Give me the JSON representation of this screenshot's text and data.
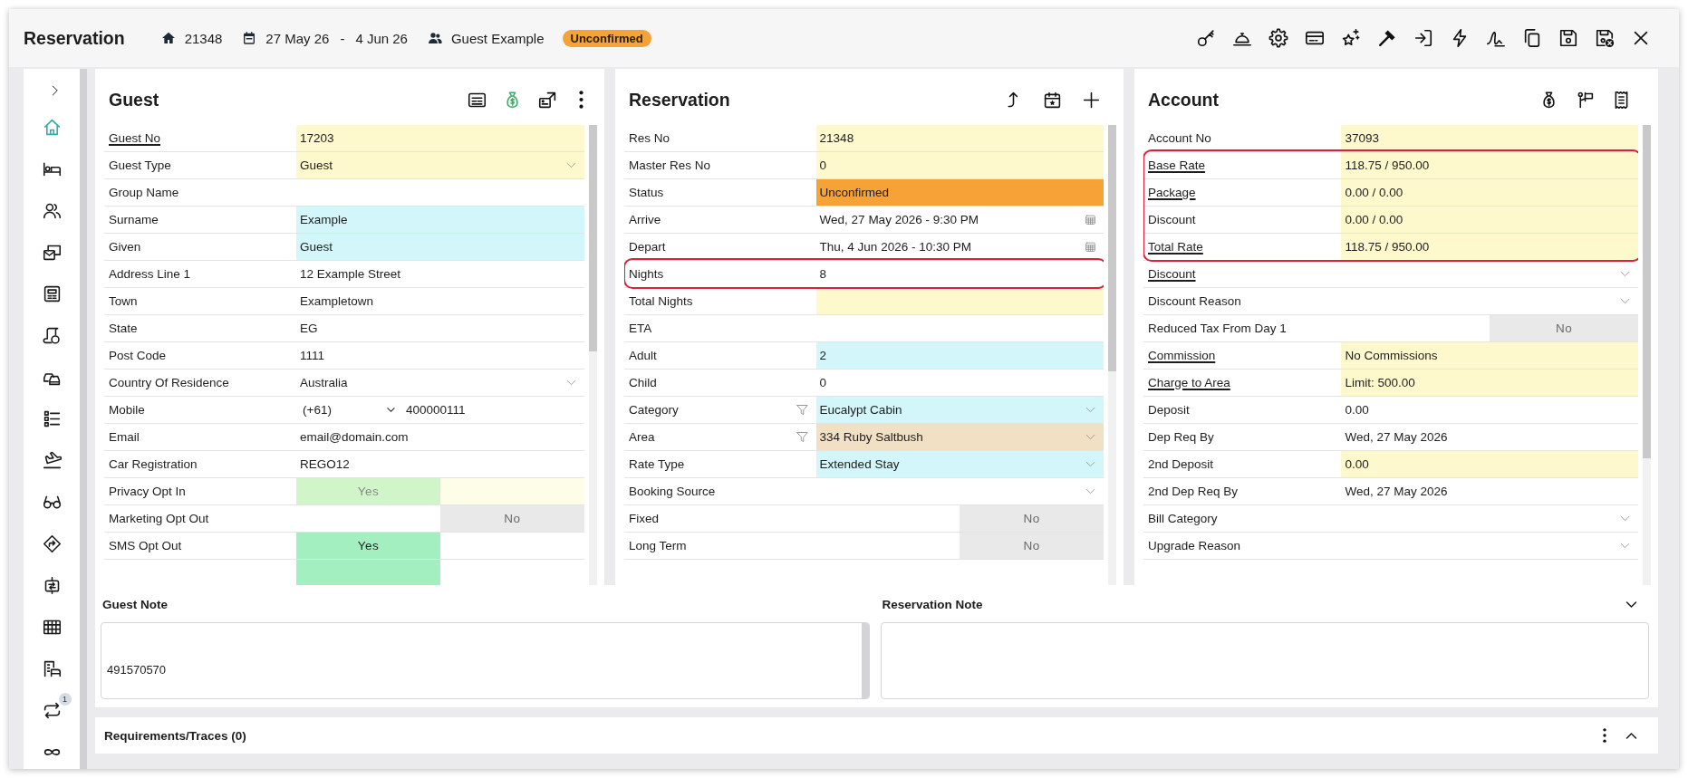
{
  "header": {
    "title": "Reservation",
    "res_no": "21348",
    "arrive": "27 May 26",
    "separator": "-",
    "depart": "4 Jun 26",
    "guest": "Guest Example",
    "status": "Unconfirmed"
  },
  "sidebar": {
    "items": [
      {
        "selected": true
      },
      {
        "selected": false
      },
      {
        "selected": false
      },
      {
        "selected": false
      },
      {
        "selected": false
      },
      {
        "selected": false
      },
      {
        "selected": false
      },
      {
        "selected": false
      },
      {
        "selected": false
      },
      {
        "selected": false
      },
      {
        "selected": false
      },
      {
        "selected": false
      },
      {
        "selected": false
      },
      {
        "selected": false
      },
      {
        "selected": false,
        "badge": "1"
      },
      {
        "selected": false
      }
    ]
  },
  "panels": [
    {
      "kind": "guest",
      "title": "Guest",
      "rows": [
        {
          "kind": "field",
          "label": "Guest No",
          "link": true,
          "value": "17203",
          "color": "#fef9cc"
        },
        {
          "kind": "select",
          "label": "Guest Type",
          "link": false,
          "value": "Guest",
          "color": "#fef9cc"
        },
        {
          "kind": "field",
          "label": "Group Name",
          "link": false
        },
        {
          "kind": "field",
          "label": "Surname",
          "link": false,
          "value": "Example",
          "color": "#d2f6f9"
        },
        {
          "kind": "field",
          "label": "Given",
          "link": false,
          "value": "Guest",
          "color": "#d2f6f9"
        },
        {
          "kind": "field",
          "label": "Address Line 1",
          "link": false,
          "value": "12 Example Street"
        },
        {
          "kind": "field",
          "label": "Town",
          "link": false,
          "value": "Exampletown"
        },
        {
          "kind": "field",
          "label": "State",
          "link": false,
          "value": "EG"
        },
        {
          "kind": "field",
          "label": "Post Code",
          "link": false,
          "value": "1111"
        },
        {
          "kind": "select",
          "label": "Country Of Residence",
          "link": false,
          "value": "Australia"
        },
        {
          "kind": "phone",
          "label": "Mobile",
          "link": false,
          "code": "(+61)",
          "value": "400000111"
        },
        {
          "kind": "field",
          "label": "Email",
          "link": false,
          "value": "email@domain.com"
        },
        {
          "kind": "field",
          "label": "Car Registration",
          "link": false,
          "value": "REGO12"
        },
        {
          "kind": "toggle",
          "label": "Privacy Opt In",
          "link": false,
          "value": "Yes",
          "on": true,
          "disabled": true,
          "color": "#fefde8"
        },
        {
          "kind": "toggle",
          "label": "Marketing Opt Out",
          "link": false,
          "value": "No",
          "on": false,
          "disabled": false
        },
        {
          "kind": "toggle",
          "label": "SMS Opt Out",
          "link": false,
          "value": "Yes",
          "on": true,
          "disabled": false
        },
        {
          "kind": "toggle",
          "on": true,
          "disabled": false
        }
      ]
    },
    {
      "kind": "reservation",
      "title": "Reservation",
      "rows": [
        {
          "kind": "field",
          "label": "Res No",
          "link": false,
          "filter": false,
          "circled": false,
          "value": "21348",
          "color": "#fef9cc"
        },
        {
          "kind": "field",
          "label": "Master Res No",
          "link": false,
          "filter": false,
          "circled": false,
          "value": "0",
          "color": "#fef9cc"
        },
        {
          "kind": "field",
          "label": "Status",
          "link": false,
          "filter": false,
          "circled": false,
          "value": "Unconfirmed",
          "color": "#f6a236"
        },
        {
          "kind": "date",
          "label": "Arrive",
          "link": false,
          "filter": false,
          "circled": false,
          "value": "Wed, 27 May 2026 - 9:30 PM"
        },
        {
          "kind": "date",
          "label": "Depart",
          "link": false,
          "filter": false,
          "circled": false,
          "value": "Thu, 4 Jun 2026 - 10:30 PM"
        },
        {
          "kind": "field",
          "label": "Nights",
          "link": false,
          "filter": false,
          "circled": true,
          "value": "8"
        },
        {
          "kind": "field",
          "label": "Total Nights",
          "link": false,
          "filter": false,
          "circled": false,
          "color": "#fef9cc"
        },
        {
          "kind": "field",
          "label": "ETA",
          "link": false,
          "filter": false,
          "circled": false
        },
        {
          "kind": "field",
          "label": "Adult",
          "link": false,
          "filter": false,
          "circled": false,
          "value": "2",
          "color": "#d2f6f9"
        },
        {
          "kind": "field",
          "label": "Child",
          "link": false,
          "filter": false,
          "circled": false,
          "value": "0"
        },
        {
          "kind": "select",
          "label": "Category",
          "link": false,
          "filter": true,
          "circled": false,
          "value": "Eucalypt Cabin",
          "color": "#d2f6f9"
        },
        {
          "kind": "select",
          "label": "Area",
          "link": false,
          "filter": true,
          "circled": false,
          "value": "334 Ruby Saltbush",
          "color": "#f2e0c4"
        },
        {
          "kind": "select",
          "label": "Rate Type",
          "link": false,
          "filter": false,
          "circled": false,
          "value": "Extended Stay",
          "color": "#d2f6f9"
        },
        {
          "kind": "select",
          "label": "Booking Source",
          "link": false,
          "filter": false,
          "circled": false
        },
        {
          "kind": "toggle",
          "label": "Fixed",
          "link": false,
          "filter": false,
          "circled": false,
          "value": "No",
          "on": false,
          "disabled": false
        },
        {
          "kind": "toggle",
          "label": "Long Term",
          "link": false,
          "filter": false,
          "circled": false,
          "value": "No",
          "on": false,
          "disabled": false
        }
      ]
    },
    {
      "kind": "account",
      "title": "Account",
      "rows": [
        {
          "kind": "field",
          "label": "Account No",
          "link": false,
          "circled": false,
          "value": "37093",
          "color": "#fef9cc"
        },
        {
          "kind": "field",
          "label": "Base Rate",
          "link": true,
          "circled": true,
          "value": "118.75 / 950.00",
          "color": "#fef9cc"
        },
        {
          "kind": "field",
          "label": "Package",
          "link": true,
          "circled": true,
          "value": "0.00 / 0.00",
          "color": "#fef9cc"
        },
        {
          "kind": "field",
          "label": "Discount",
          "link": false,
          "circled": true,
          "value": "0.00 / 0.00",
          "color": "#fef9cc"
        },
        {
          "kind": "field",
          "label": "Total Rate",
          "link": true,
          "circled": true,
          "value": "118.75 / 950.00",
          "color": "#fef9cc"
        },
        {
          "kind": "select",
          "label": "Discount",
          "link": true,
          "circled": false
        },
        {
          "kind": "select",
          "label": "Discount Reason",
          "link": false,
          "circled": false
        },
        {
          "kind": "toggle",
          "label": "Reduced Tax From Day 1",
          "link": false,
          "circled": false,
          "value": "No",
          "on": false,
          "disabled": false
        },
        {
          "kind": "field",
          "label": "Commission",
          "link": true,
          "circled": false,
          "value": "No Commissions",
          "color": "#fef9cc"
        },
        {
          "kind": "field",
          "label": "Charge to Area",
          "link": true,
          "circled": false,
          "value": "Limit: 500.00",
          "color": "#fef9cc"
        },
        {
          "kind": "field",
          "label": "Deposit",
          "link": false,
          "circled": false,
          "value": "0.00"
        },
        {
          "kind": "field",
          "label": "Dep Req By",
          "link": false,
          "circled": false,
          "value": "Wed, 27 May 2026"
        },
        {
          "kind": "field",
          "label": "2nd Deposit",
          "link": false,
          "circled": false,
          "value": "0.00",
          "color": "#fef9cc"
        },
        {
          "kind": "field",
          "label": "2nd Dep Req By",
          "link": false,
          "circled": false,
          "value": "Wed, 27 May 2026"
        },
        {
          "kind": "select",
          "label": "Bill Category",
          "link": false,
          "circled": false
        },
        {
          "kind": "select",
          "label": "Upgrade Reason",
          "link": false,
          "circled": false
        }
      ]
    }
  ],
  "notes": [
    {
      "label": "Guest Note",
      "value": "491570570"
    },
    {
      "label": "Reservation Note"
    }
  ],
  "requirements": {
    "title": "Requirements/Traces (0)"
  }
}
